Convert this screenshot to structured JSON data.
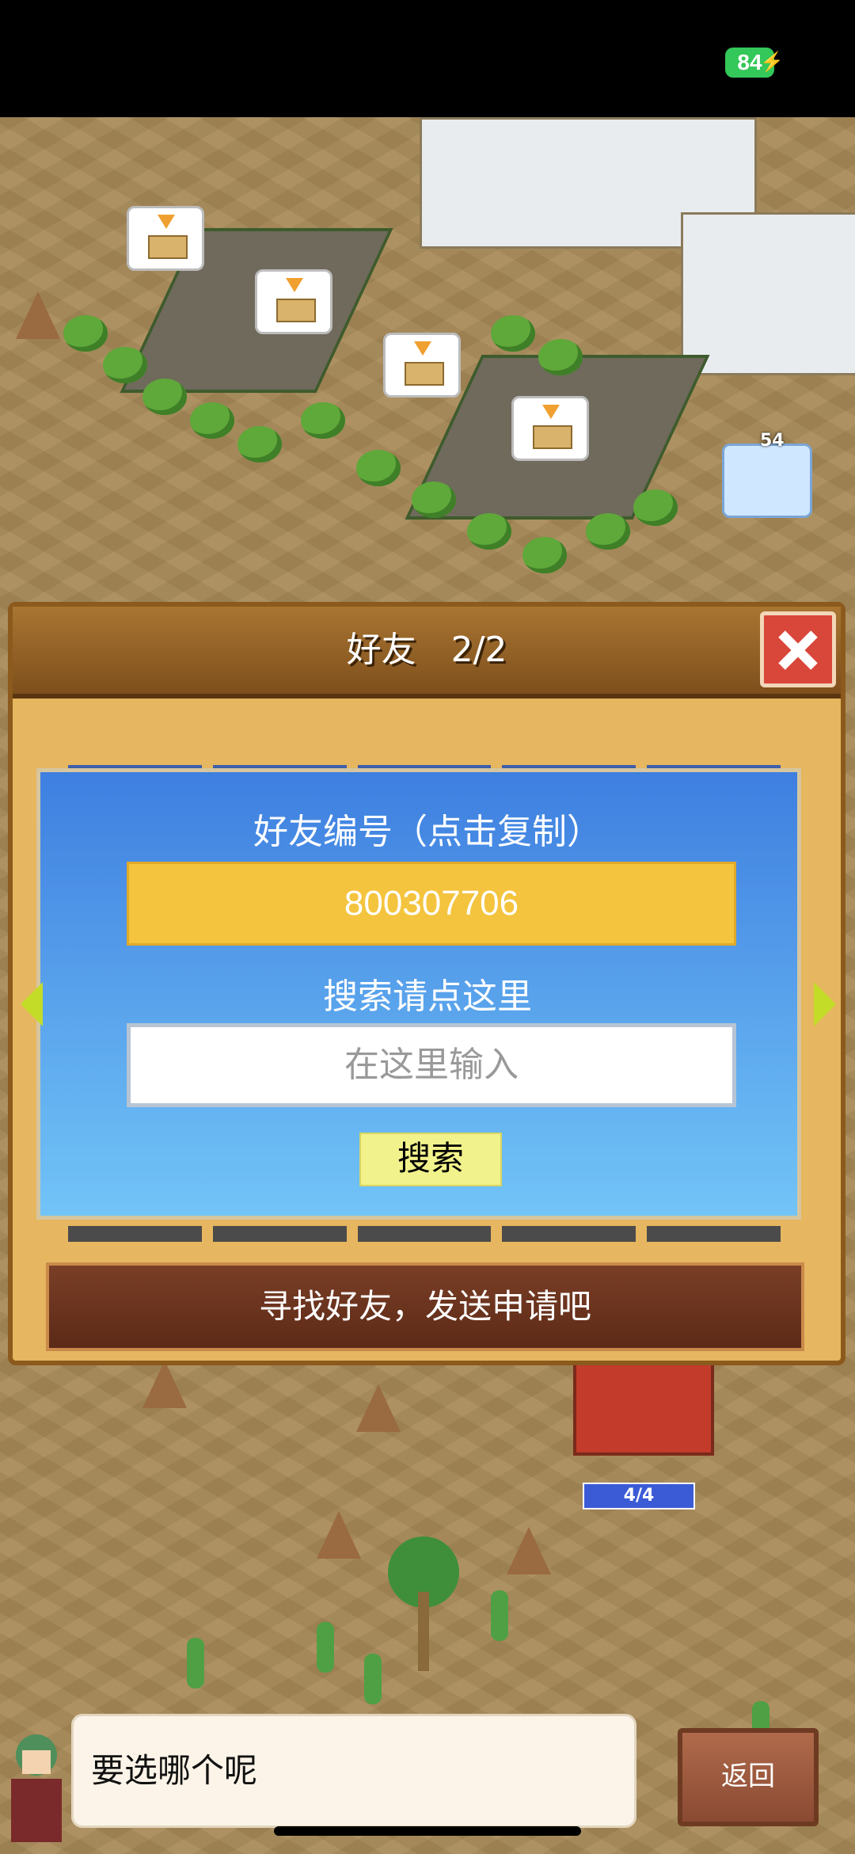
{
  "status_bar": {
    "battery_level": "84"
  },
  "game": {
    "ship_count": "54",
    "shop_count": "4/4"
  },
  "dialog": {
    "title": "好友　2/2",
    "id_label": "好友编号（点击复制）",
    "friend_id": "800307706",
    "search_label": "搜索请点这里",
    "search_placeholder": "在这里输入",
    "search_button": "搜索",
    "find_banner": "寻找好友，发送申请吧"
  },
  "bottom": {
    "speech_text": "要选哪个呢",
    "back_button": "返回"
  },
  "colors": {
    "accent": "#f4c43e",
    "panel_blue": "#3e7fe0",
    "close_red": "#d9463a",
    "dialog_wood": "#e6b660"
  },
  "icons": [
    "battery-icon",
    "close-icon",
    "crate-icon",
    "ship-icon",
    "arrow-left-icon",
    "arrow-right-icon"
  ]
}
